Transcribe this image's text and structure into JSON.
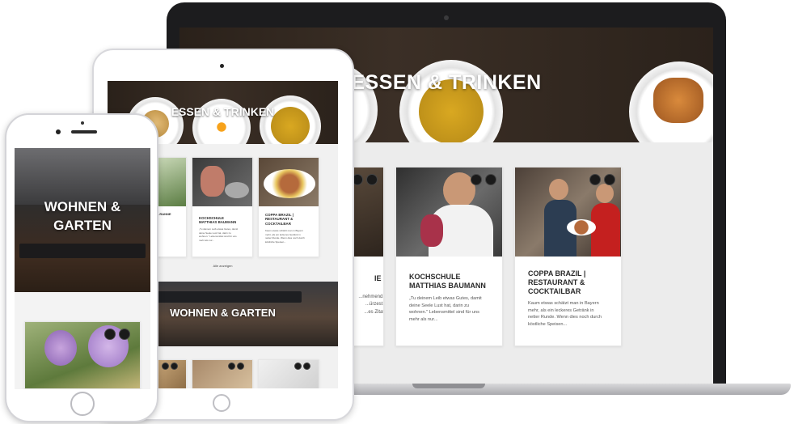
{
  "laptop": {
    "hero_title": "ESSEN & TRINKEN",
    "cards": [
      {
        "title_line1": "",
        "title_line2": "IE",
        "text": [
          "...nehmend,",
          "...ürzest,",
          "...es Zitat"
        ]
      },
      {
        "title_line1": "KOCHSCHULE",
        "title_line2": "MATTHIAS BAUMANN",
        "text": [
          "„Tu deinem Leib etwas Gutes, damit",
          "deine Seele Lust hat, darin zu",
          "wohnen.\" Lebensmittel sind für uns",
          "mehr als nur..."
        ]
      },
      {
        "title_line1": "COPPA BRAZIL |",
        "title_line2": "RESTAURANT &",
        "title_line3": "COCKTAILBAR",
        "text": [
          "Kaum etwas schätzt man in Bayern",
          "mehr, als ein leckeres Getränk in",
          "netter Runde. Wenn dies noch durch",
          "köstliche Speisen..."
        ]
      }
    ]
  },
  "tablet": {
    "hero_title": "ESSEN & TRINKEN",
    "cards": [
      {
        "title_line1": "...RANNE",
        "text": [
          "...",
          "..."
        ]
      },
      {
        "title_line1": "KOCHSCHULE",
        "title_line2": "MATTHIAS BAUMANN",
        "text": [
          "„Tu deinem Leib etwas Gutes, damit",
          "deine Seele Lust hat, darin zu",
          "wohnen.\" Lebensmittel sind für uns",
          "mehr als nur..."
        ]
      },
      {
        "title_line1": "COPPA BRAZIL |",
        "title_line2": "RESTAURANT &",
        "title_line3": "COCKTAILBAR",
        "text": [
          "Kaum etwas schätzt man in Bayern",
          "mehr, als ein leckeres Getränk in",
          "netter Runde. Wenn dies noch durch",
          "köstliche Speisen..."
        ]
      }
    ],
    "show_all_link": "Alle anzeigen",
    "section2_title": "WOHNEN & GARTEN"
  },
  "phone": {
    "hero_title_line1": "WOHNEN &",
    "hero_title_line2": "GARTEN"
  },
  "colors": {
    "hero_dark": "#2e241c",
    "device_black": "#1c1c1e",
    "card_title": "#2a2a2a",
    "body_text": "#555555"
  }
}
